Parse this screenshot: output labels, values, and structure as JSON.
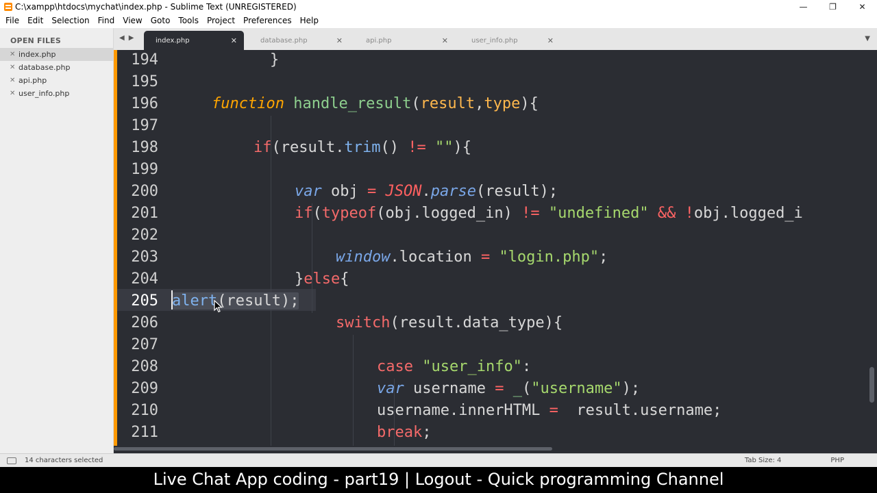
{
  "window": {
    "title": "C:\\xampp\\htdocs\\mychat\\index.php - Sublime Text (UNREGISTERED)",
    "controls": [
      "—",
      "❐",
      "✕"
    ]
  },
  "menu": [
    "File",
    "Edit",
    "Selection",
    "Find",
    "View",
    "Goto",
    "Tools",
    "Project",
    "Preferences",
    "Help"
  ],
  "sidebar": {
    "header": "OPEN FILES",
    "files": [
      "index.php",
      "database.php",
      "api.php",
      "user_info.php"
    ],
    "active_file": "index.php"
  },
  "tabs": [
    {
      "label": "index.php",
      "active": true
    },
    {
      "label": "database.php",
      "active": false
    },
    {
      "label": "api.php",
      "active": false
    },
    {
      "label": "user_info.php",
      "active": false
    }
  ],
  "editor": {
    "line_numbers": [
      "194",
      "195",
      "196",
      "197",
      "198",
      "199",
      "200",
      "201",
      "202",
      "203",
      "204",
      "205",
      "206",
      "207",
      "208",
      "209",
      "210",
      "211"
    ],
    "current_line": "205",
    "accent_color": "#ff9900",
    "background": "#2b2d33"
  },
  "status": {
    "selection": "14 characters selected",
    "tab_size": "Tab Size: 4",
    "syntax": "PHP"
  },
  "caption": "Live Chat App coding - part19 | Logout - Quick programming Channel"
}
